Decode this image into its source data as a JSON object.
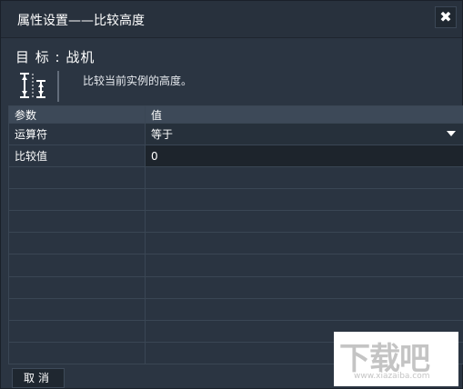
{
  "window": {
    "title": "属性设置——比较高度",
    "close_label": "✖"
  },
  "header": {
    "target": "目  标 : 战机",
    "description": "比较当前实例的高度。",
    "icon": "height-compare-icon"
  },
  "grid": {
    "columns": [
      "参数",
      "值"
    ],
    "rows": [
      {
        "name": "运算符",
        "value": "等于"
      },
      {
        "name": "比较值",
        "value": "0"
      }
    ]
  },
  "footer": {
    "cancel_label": "取消"
  },
  "watermark": {
    "text": "下载吧",
    "url": "www.xiazaiba.com"
  }
}
